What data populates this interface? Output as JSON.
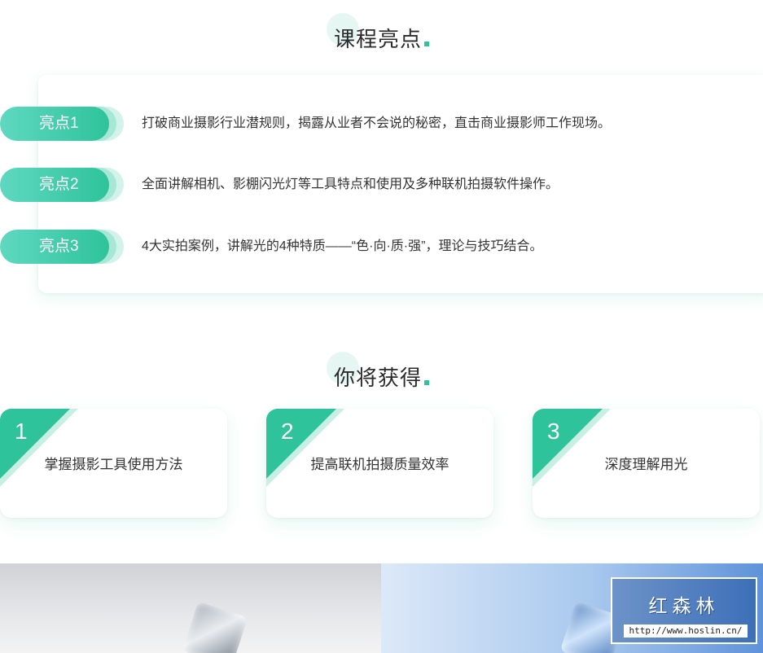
{
  "highlights": {
    "title": "课程亮点",
    "items": [
      {
        "badge": "亮点1",
        "text": "打破商业摄影行业潜规则，揭露从业者不会说的秘密，直击商业摄影师工作现场。"
      },
      {
        "badge": "亮点2",
        "text": "全面讲解相机、影棚闪光灯等工具特点和使用及多种联机拍摄软件操作。"
      },
      {
        "badge": "亮点3",
        "text": "4大实拍案例，讲解光的4种特质——“色·向·质·强”，理论与技巧结合。"
      }
    ]
  },
  "gains": {
    "title": "你将获得",
    "items": [
      {
        "num": "1",
        "text": "掌握摄影工具使用方法"
      },
      {
        "num": "2",
        "text": "提高联机拍摄质量效率"
      },
      {
        "num": "3",
        "text": "深度理解用光"
      }
    ]
  },
  "watermark": {
    "title": "红森林",
    "url": "http://www.hoslin.cn/"
  },
  "colors": {
    "accent": "#2ec39b",
    "accent_light": "#5fd8c0"
  }
}
